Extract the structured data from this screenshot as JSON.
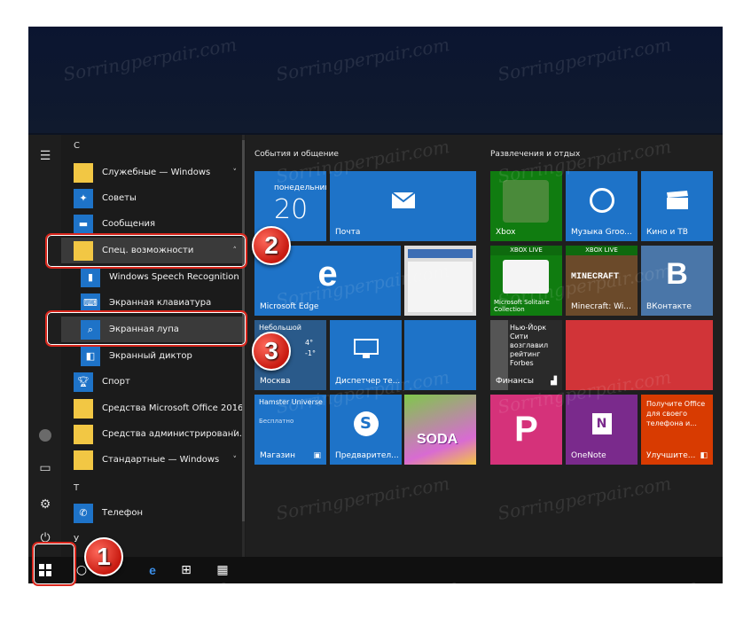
{
  "watermark": "Sorringperpair.com",
  "applist": {
    "letter_c": "С",
    "letter_t": "Т",
    "letter_u": "У",
    "items": [
      {
        "label": "Служебные — Windows",
        "chev": "˅"
      },
      {
        "label": "Советы"
      },
      {
        "label": "Сообщения"
      },
      {
        "label": "Спец. возможности",
        "chev": "˄"
      },
      {
        "label": "Windows Speech Recognition"
      },
      {
        "label": "Экранная клавиатура"
      },
      {
        "label": "Экранная лупа"
      },
      {
        "label": "Экранный диктор"
      },
      {
        "label": "Спорт"
      },
      {
        "label": "Средства Microsoft Office 2016",
        "chev": "˅"
      },
      {
        "label": "Средства администрировани...",
        "chev": "˅"
      },
      {
        "label": "Стандартные — Windows",
        "chev": "˅"
      },
      {
        "label": "Телефон"
      }
    ]
  },
  "groups": {
    "left": "События и общение",
    "right": "Развлечения и отдых"
  },
  "tiles": {
    "calendar_day": "понедельник",
    "calendar_date": "20",
    "mail": "Почта",
    "edge": "Microsoft Edge",
    "weather_desc": "Небольшой дождь",
    "weather_temp": "4°",
    "weather_hi": "4°",
    "weather_lo": "-1°",
    "weather_city": "Москва",
    "taskmgr": "Диспетчер те...",
    "store_title": "Hamster Universe",
    "store_sub": "Бесплатно",
    "store": "Магазин",
    "skype": "Предварител...",
    "candy_text": "SODA",
    "xbox": "Xbox",
    "groove": "Музыка Groo...",
    "movies": "Кино и ТВ",
    "xbox_live": "XBOX LIVE",
    "solitaire": "Microsoft Solitaire Collection",
    "minecraft_banner": "MINECRAFT",
    "minecraft": "Minecraft: Wi...",
    "vk_logo": "B",
    "vk": "ВКонтакте",
    "finance_news": "Нью-Йорк Сити возглавил рейтинг Forbes",
    "finance": "Финансы",
    "onenote": "OneNote",
    "office_text": "Получите Office для своего телефона и...",
    "office": "Улучшите..."
  },
  "badges": {
    "one": "1",
    "two": "2",
    "three": "3"
  },
  "colors": {
    "tile_blue": "#1e73c8",
    "callout_red": "#d9261c",
    "office_red": "#d83b01",
    "onenote_purple": "#7a2a8c"
  }
}
